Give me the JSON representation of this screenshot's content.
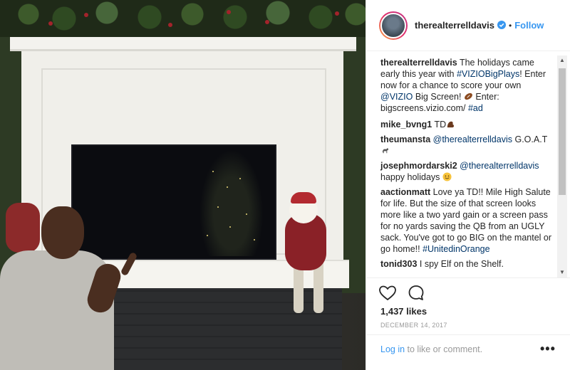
{
  "post": {
    "username": "therealterrelldavis",
    "follow_label": "Follow",
    "separator": "•"
  },
  "comments": [
    {
      "user": "therealterrelldavis",
      "text": " The holidays came early this year with ",
      "tag1": "#VIZIOBigPlays",
      "text2": "! Enter now for a chance to score your own ",
      "tag2": "@VIZIO",
      "text3": " Big Screen! ",
      "text4": " Enter: bigscreens.vizio.com/ ",
      "tag3": "#ad"
    },
    {
      "user": "mike_bvng1",
      "text": " TD"
    },
    {
      "user": "theumansta",
      "mention": "@therealterrelldavis",
      "text": " G.O.A.T"
    },
    {
      "user": "josephmordarski2",
      "mention": "@therealterrelldavis",
      "text": " happy holidays "
    },
    {
      "user": "aactionmatt",
      "text": " Love ya TD!! Mile High Salute for life. But the size of that screen looks more like a two yard gain or a screen pass for no yards saving the QB from an UGLY sack. You've got to go BIG on the mantel or go home!! ",
      "tag": "#UnitedinOrange"
    },
    {
      "user": "tonid303",
      "text": " I spy Elf on the Shelf."
    }
  ],
  "footer": {
    "likes": "1,437 likes",
    "date": "DECEMBER 14, 2017",
    "login_link": "Log in",
    "login_text": " to like or comment.",
    "more": "•••"
  },
  "icons": {
    "verified": "verified-badge-icon",
    "like": "heart-icon",
    "comment": "comment-bubble-icon",
    "more": "more-options-icon"
  },
  "colors": {
    "link_blue": "#3897f0",
    "tag_blue": "#003569",
    "text": "#262626",
    "muted": "#999999"
  }
}
